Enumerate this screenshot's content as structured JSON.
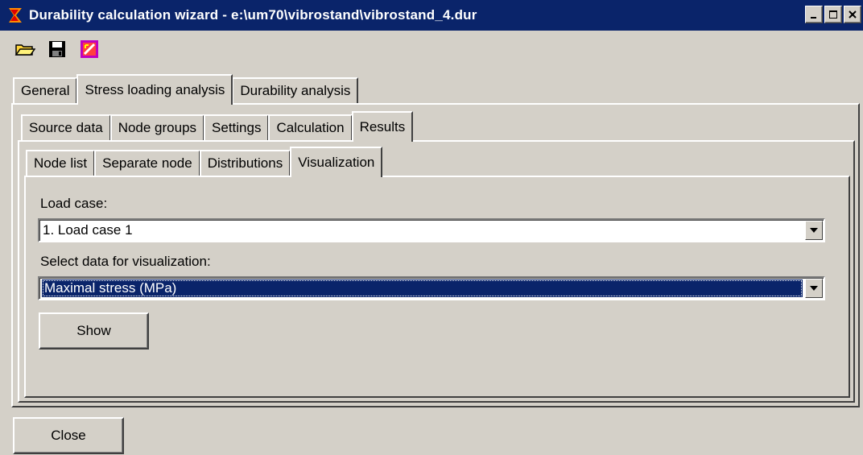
{
  "window": {
    "title": "Durability calculation wizard - e:\\um70\\vibrostand\\vibrostand_4.dur"
  },
  "toolbar": {
    "icons": [
      "open-folder-icon",
      "save-icon",
      "wizard-icon"
    ]
  },
  "main_tabs": [
    "General",
    "Stress loading analysis",
    "Durability analysis"
  ],
  "analysis_tabs": [
    "Source data",
    "Node groups",
    "Settings",
    "Calculation",
    "Results"
  ],
  "results_tabs": [
    "Node list",
    "Separate node",
    "Distributions",
    "Visualization"
  ],
  "visualization": {
    "load_case_label": "Load case:",
    "load_case_value": "1. Load case 1",
    "data_label": "Select data for visualization:",
    "data_value": "Maximal stress (MPa)",
    "show_label": "Show"
  },
  "footer": {
    "close_label": "Close"
  },
  "colors": {
    "title_bar": "#0a246a",
    "face": "#d4d0c8",
    "selection": "#0a246a"
  }
}
